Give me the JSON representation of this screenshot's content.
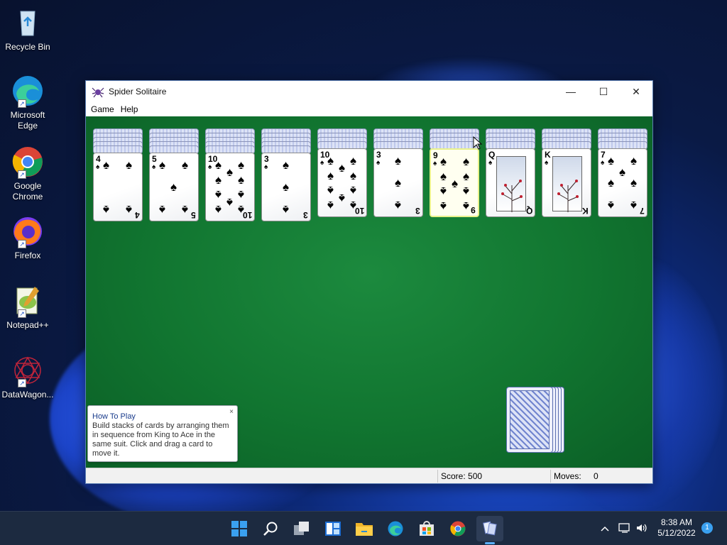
{
  "desktop": {
    "icons": [
      {
        "label": "Recycle Bin",
        "icon": "recycle-bin-icon"
      },
      {
        "label": "Microsoft Edge",
        "icon": "edge-icon"
      },
      {
        "label": "Google Chrome",
        "icon": "chrome-icon"
      },
      {
        "label": "Firefox",
        "icon": "firefox-icon"
      },
      {
        "label": "Notepad++",
        "icon": "notepad-plus-plus-icon"
      },
      {
        "label": "DataWagon...",
        "icon": "datawagon-icon"
      }
    ]
  },
  "window": {
    "title": "Spider Solitaire",
    "minimize": "—",
    "maximize": "☐",
    "close": "✕",
    "menu": {
      "game": "Game",
      "help": "Help"
    }
  },
  "game": {
    "felt_color": "#117530",
    "suit": "♠",
    "piles": [
      {
        "face_down": 5,
        "top": "4"
      },
      {
        "face_down": 5,
        "top": "5"
      },
      {
        "face_down": 5,
        "top": "10"
      },
      {
        "face_down": 5,
        "top": "3"
      },
      {
        "face_down": 4,
        "top": "10"
      },
      {
        "face_down": 4,
        "top": "3"
      },
      {
        "face_down": 4,
        "top": "9",
        "highlighted": true
      },
      {
        "face_down": 4,
        "top": "Q"
      },
      {
        "face_down": 4,
        "top": "K"
      },
      {
        "face_down": 4,
        "top": "7"
      }
    ],
    "stock_count": 5
  },
  "tooltip": {
    "title": "How To Play",
    "body": "Build stacks of cards by arranging them in sequence from King to Ace in the same suit. Click and drag a card to move it.",
    "close": "×"
  },
  "status": {
    "score_label": "Score:",
    "score": "500",
    "moves_label": "Moves:",
    "moves": "0"
  },
  "taskbar": {
    "apps": [
      "start-icon",
      "search-icon",
      "task-view-icon",
      "widgets-icon",
      "file-explorer-icon",
      "edge-icon",
      "store-icon",
      "chrome-icon",
      "spider-solitaire-icon"
    ],
    "time": "8:38 AM",
    "date": "5/12/2022",
    "notifications": "1",
    "tray_chevron": "^"
  }
}
